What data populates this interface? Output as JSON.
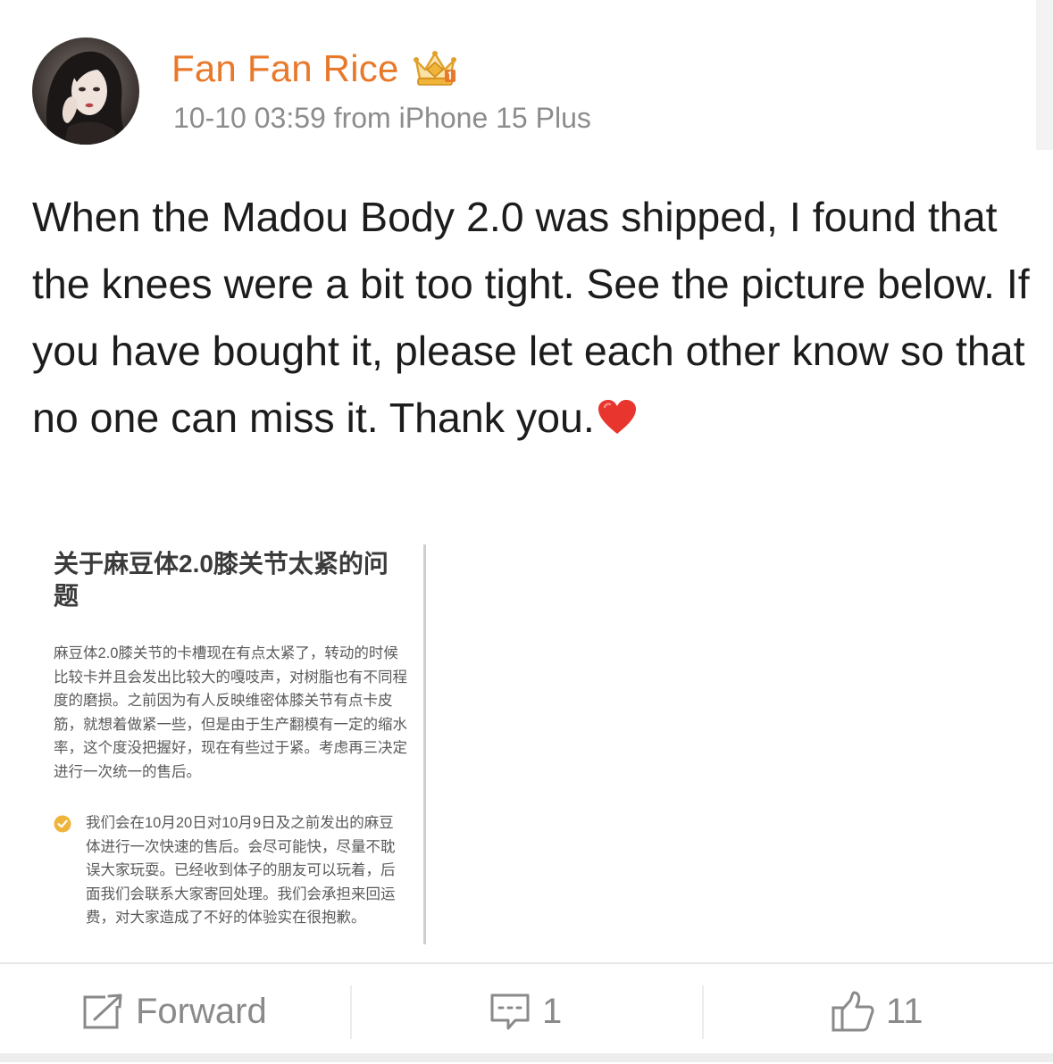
{
  "post": {
    "username": "Fan Fan Rice",
    "meta": "10-10 03:59 from iPhone 15 Plus",
    "text": "When the Madou Body 2.0 was shipped, I found that the knees were a bit too tight. See the picture below. If you have bought it, please let each other know so that no one can miss it. Thank you.",
    "icons": {
      "avatar": "avatar",
      "badge": "crown-badge-icon",
      "emoji": "red-heart-icon"
    }
  },
  "embedded_image": {
    "title": "关于麻豆体2.0膝关节太紧的问题",
    "body": "麻豆体2.0膝关节的卡槽现在有点太紧了，转动的时候比较卡并且会发出比较大的嘎吱声，对树脂也有不同程度的磨损。之前因为有人反映维密体膝关节有点卡皮筋，就想着做紧一些，但是由于生产翻模有一定的缩水率，这个度没把握好，现在有些过于紧。考虑再三决定进行一次统一的售后。",
    "note": "我们会在10月20日对10月9日及之前发出的麻豆体进行一次快速的售后。会尽可能快，尽量不耽误大家玩耍。已经收到体子的朋友可以玩着，后面我们会联系大家寄回处理。我们会承担来回运费，对大家造成了不好的体验实在很抱歉。",
    "note_icon": "check-circle-icon"
  },
  "actions": {
    "forward_label": "Forward",
    "comment_count": "1",
    "like_count": "11"
  },
  "colors": {
    "username": "#e8792b",
    "meta": "#8c8c8c",
    "text": "#1c1c1c",
    "action": "#8a8a8a",
    "heart": "#e8352e",
    "badge": "#f0b43a"
  }
}
